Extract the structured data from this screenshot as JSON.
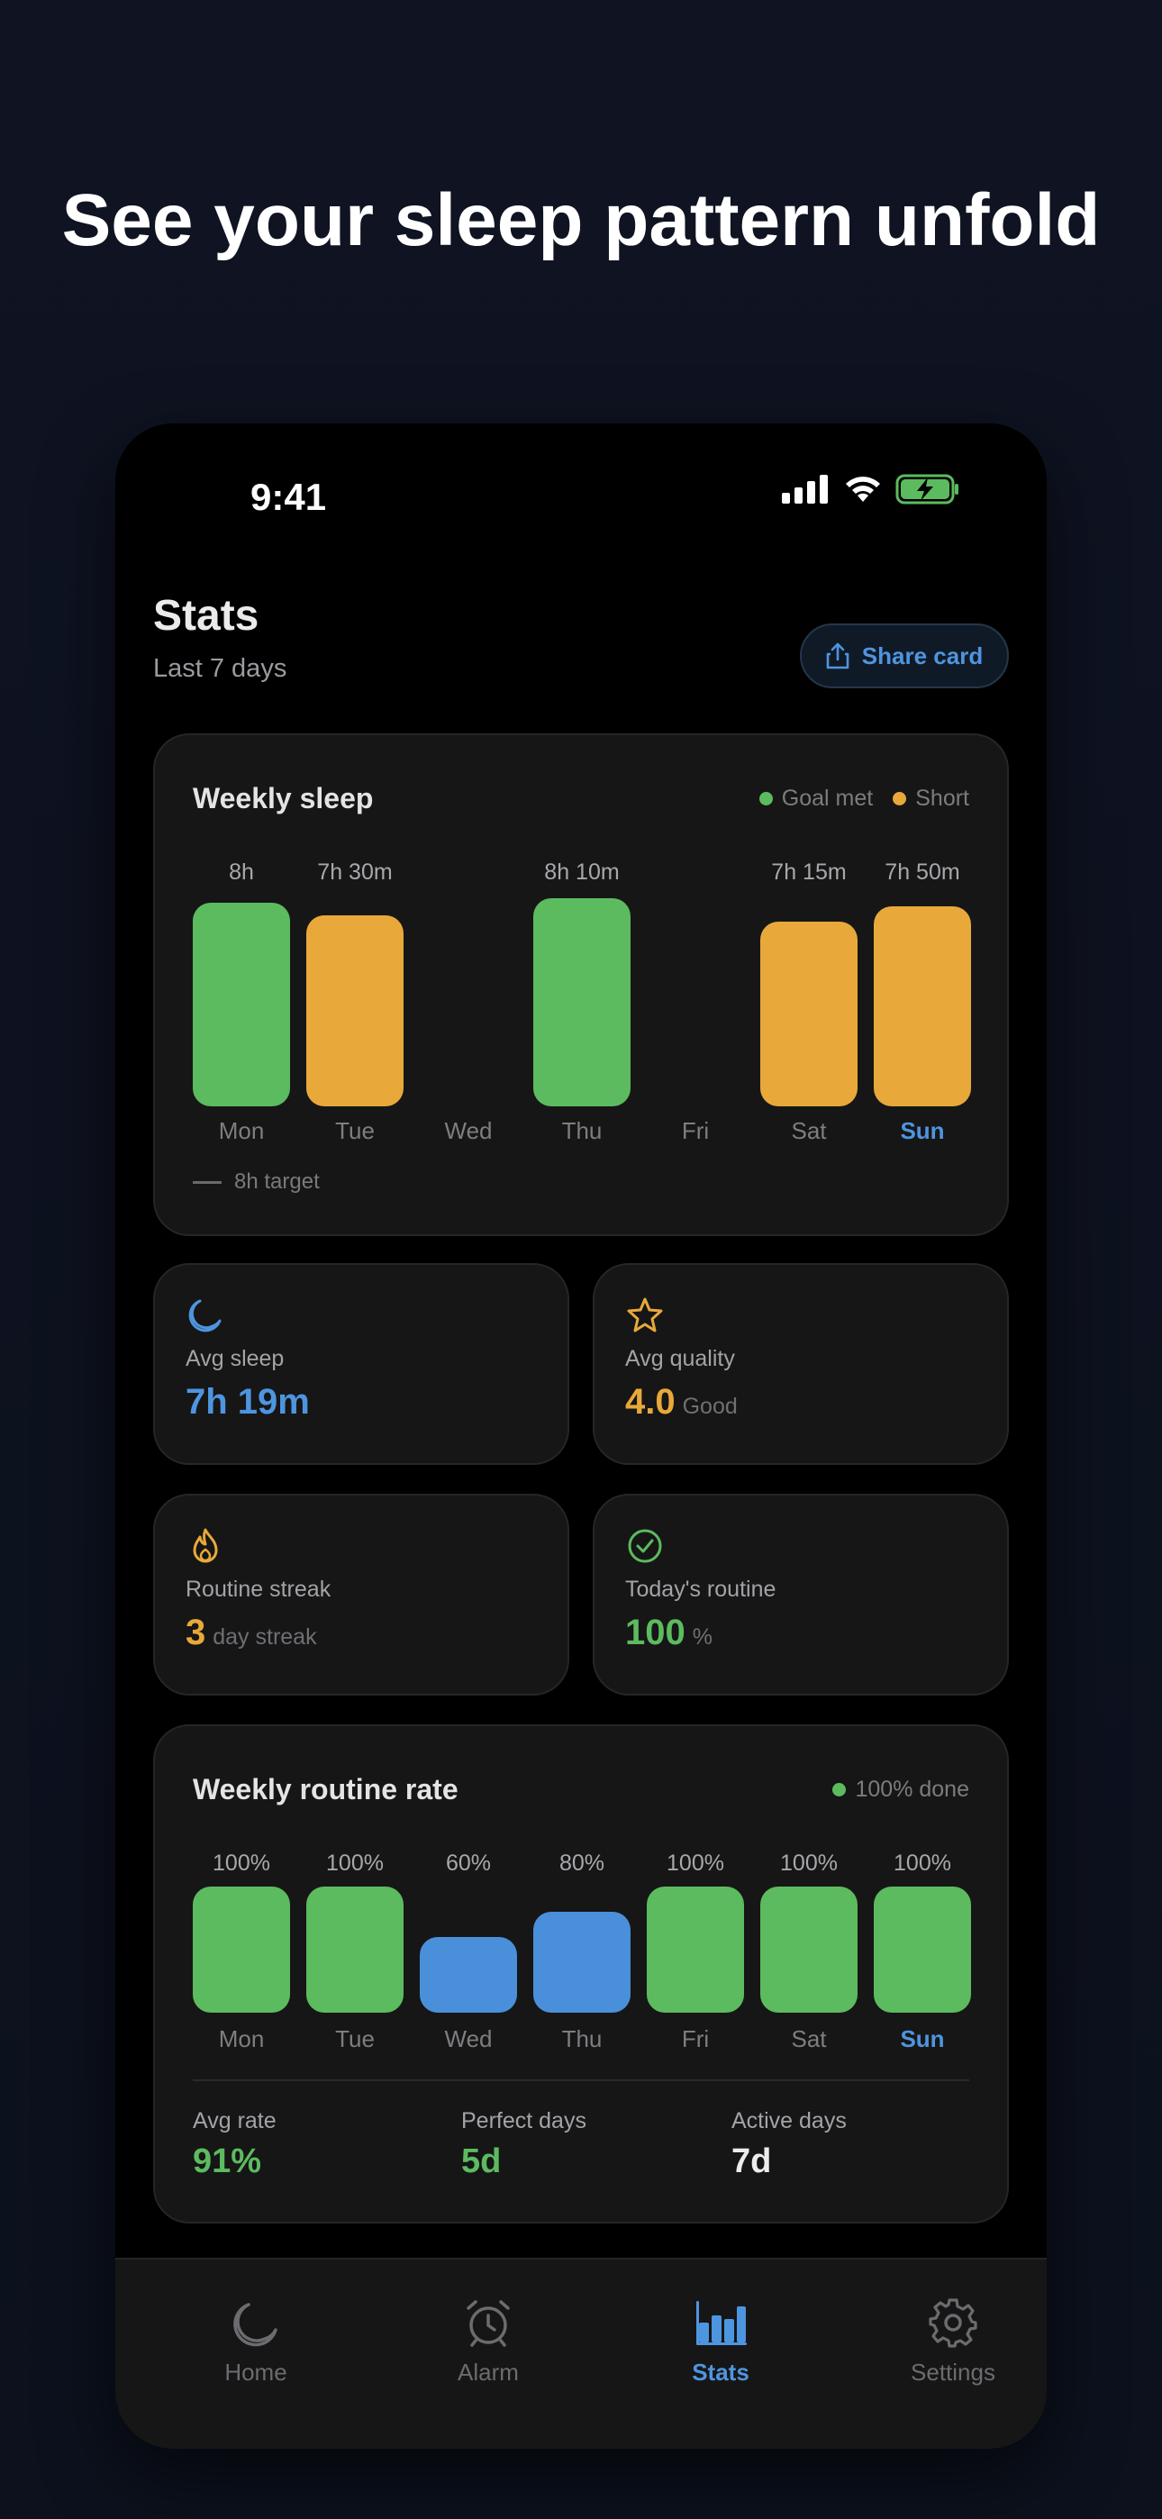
{
  "headline": "See your sleep pattern unfold",
  "status_bar": {
    "time": "9:41"
  },
  "header": {
    "title": "Stats",
    "subtitle": "Last 7 days",
    "share_label": "Share card"
  },
  "weekly_sleep": {
    "title": "Weekly sleep",
    "legend": {
      "goal_met": "Goal met",
      "short": "Short"
    },
    "target_label": "8h target",
    "days": [
      {
        "day": "Mon",
        "label": "8h",
        "hours": 8.0,
        "status": "goal"
      },
      {
        "day": "Tue",
        "label": "7h 30m",
        "hours": 7.5,
        "status": "short"
      },
      {
        "day": "Wed",
        "label": "",
        "hours": 0,
        "status": "none"
      },
      {
        "day": "Thu",
        "label": "8h 10m",
        "hours": 8.17,
        "status": "goal"
      },
      {
        "day": "Fri",
        "label": "",
        "hours": 0,
        "status": "none"
      },
      {
        "day": "Sat",
        "label": "7h 15m",
        "hours": 7.25,
        "status": "short"
      },
      {
        "day": "Sun",
        "label": "7h 50m",
        "hours": 7.83,
        "status": "short"
      }
    ]
  },
  "stats": {
    "avg_sleep": {
      "label": "Avg sleep",
      "value": "7h 19m"
    },
    "avg_quality": {
      "label": "Avg quality",
      "value": "4.0",
      "unit": "Good"
    },
    "routine_streak": {
      "label": "Routine streak",
      "value": "3",
      "unit": "day streak"
    },
    "todays_routine": {
      "label": "Today's routine",
      "value": "100",
      "unit": "%"
    }
  },
  "routine_rate": {
    "title": "Weekly routine rate",
    "legend": "100% done",
    "days": [
      {
        "day": "Mon",
        "label": "100%",
        "percent": 100
      },
      {
        "day": "Tue",
        "label": "100%",
        "percent": 100
      },
      {
        "day": "Wed",
        "label": "60%",
        "percent": 60
      },
      {
        "day": "Thu",
        "label": "80%",
        "percent": 80
      },
      {
        "day": "Fri",
        "label": "100%",
        "percent": 100
      },
      {
        "day": "Sat",
        "label": "100%",
        "percent": 100
      },
      {
        "day": "Sun",
        "label": "100%",
        "percent": 100
      }
    ],
    "summary": {
      "avg_rate_label": "Avg rate",
      "avg_rate_value": "91%",
      "perfect_days_label": "Perfect days",
      "perfect_days_value": "5d",
      "active_days_label": "Active days",
      "active_days_value": "7d"
    }
  },
  "tabs": [
    {
      "label": "Home",
      "icon": "moon-icon"
    },
    {
      "label": "Alarm",
      "icon": "alarm-icon"
    },
    {
      "label": "Stats",
      "icon": "bar-chart-icon",
      "active": true
    },
    {
      "label": "Settings",
      "icon": "gear-icon"
    }
  ],
  "colors": {
    "goal": "#5cbb5f",
    "short": "#e8a93a",
    "partial": "#4a8fd9",
    "accent": "#4e95e0"
  }
}
